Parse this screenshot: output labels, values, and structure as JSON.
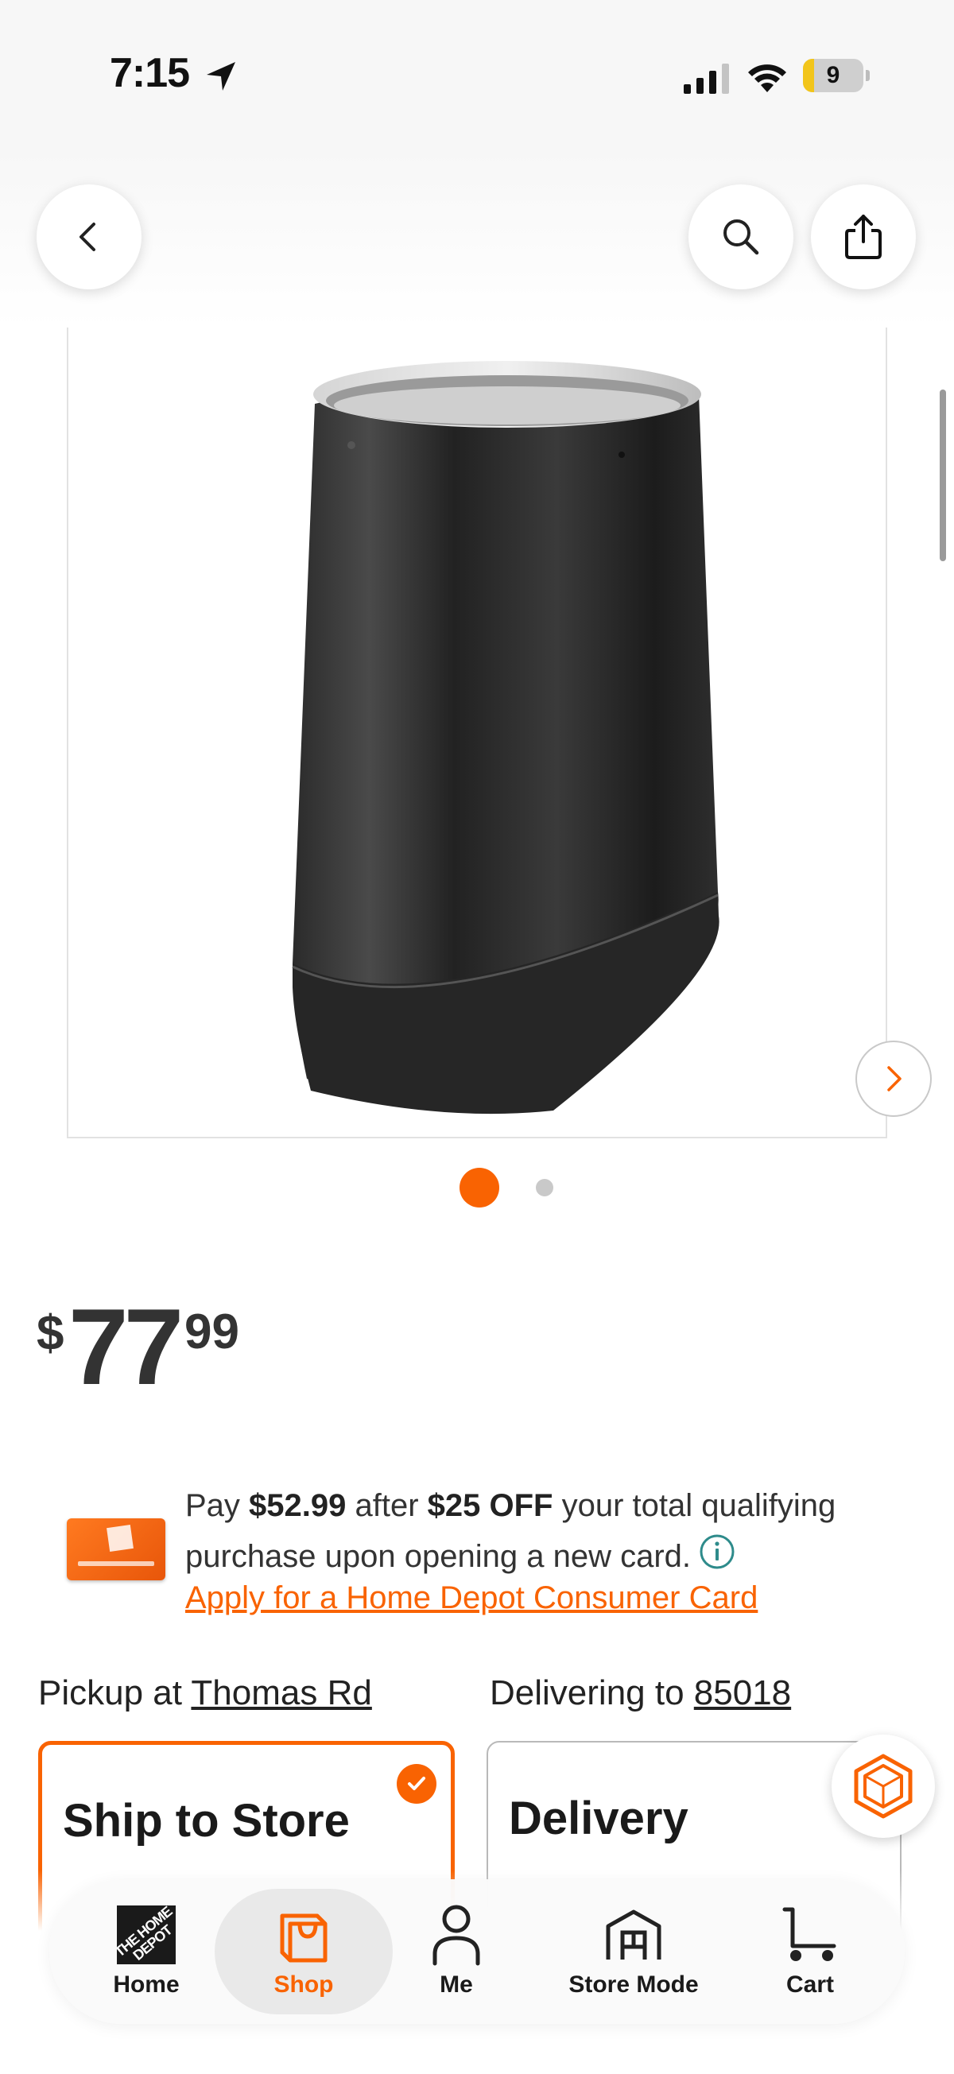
{
  "status_bar": {
    "time": "7:15",
    "battery_level": "9",
    "battery_fraction": 0.09
  },
  "header": {
    "back_icon": "chevron-left-icon",
    "search_icon": "search-icon",
    "share_icon": "share-icon"
  },
  "gallery": {
    "image_count": 2,
    "active_index": 0,
    "next_icon": "chevron-right-icon"
  },
  "price": {
    "currency": "$",
    "dollars": "77",
    "cents": "99"
  },
  "promo": {
    "prefix": "Pay ",
    "after_price": "$52.99",
    "mid": " after ",
    "discount": "$25 OFF",
    "suffix": " your total qualifying purchase upon opening a new card.",
    "link": "Apply for a Home Depot Consumer Card"
  },
  "fulfillment": {
    "pickup_label": "Pickup at ",
    "pickup_store": "Thomas Rd",
    "delivering_label": "Delivering to ",
    "delivering_zip": "85018",
    "options": [
      {
        "title": "Ship to Store",
        "selected": true
      },
      {
        "title": "Delivery",
        "selected": false
      }
    ]
  },
  "nav": {
    "items": [
      {
        "label": "Home",
        "icon": "home-depot-logo-icon"
      },
      {
        "label": "Shop",
        "icon": "shop-bag-icon",
        "active": true
      },
      {
        "label": "Me",
        "icon": "person-icon"
      },
      {
        "label": "Store Mode",
        "icon": "store-icon"
      },
      {
        "label": "Cart",
        "icon": "cart-icon"
      }
    ]
  },
  "colors": {
    "brand_orange": "#f96302",
    "text": "#333333",
    "info_teal": "#2e8b8b"
  }
}
